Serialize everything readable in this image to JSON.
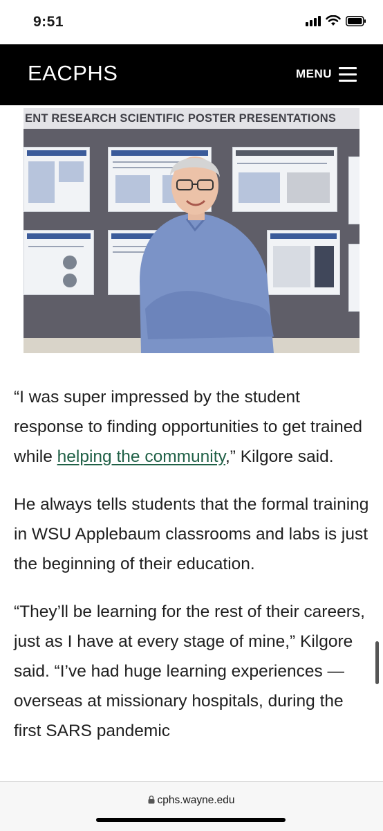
{
  "status_bar": {
    "time": "9:51",
    "icons": [
      "cellular-signal-icon",
      "wifi-icon",
      "battery-icon"
    ]
  },
  "header": {
    "brand": "EACPHS",
    "menu_label": "MENU",
    "background_color": "#000000",
    "text_color": "#ffffff"
  },
  "photo": {
    "banner_text": "ENT RESEARCH SCIENTIFIC POSTER PRESENTATIONS"
  },
  "article": {
    "p1_before_link": "“I was super impressed by the student response to finding opportunities to get trained while ",
    "p1_link_text": "helping the community",
    "p1_after_link": ",” Kilgore said.",
    "p2": "He always tells students that the formal training in WSU Applebaum classrooms and labs is just the beginning of their education.",
    "p3": "“They’ll be learning for the rest of their careers, just as I have at every stage of mine,” Kilgore said. “I’ve had huge learning experiences — overseas at missionary hospitals, during the first SARS pandemic",
    "link_color": "#1f6046"
  },
  "browser": {
    "url": "cphs.wayne.edu",
    "lock_icon": "lock-icon"
  }
}
